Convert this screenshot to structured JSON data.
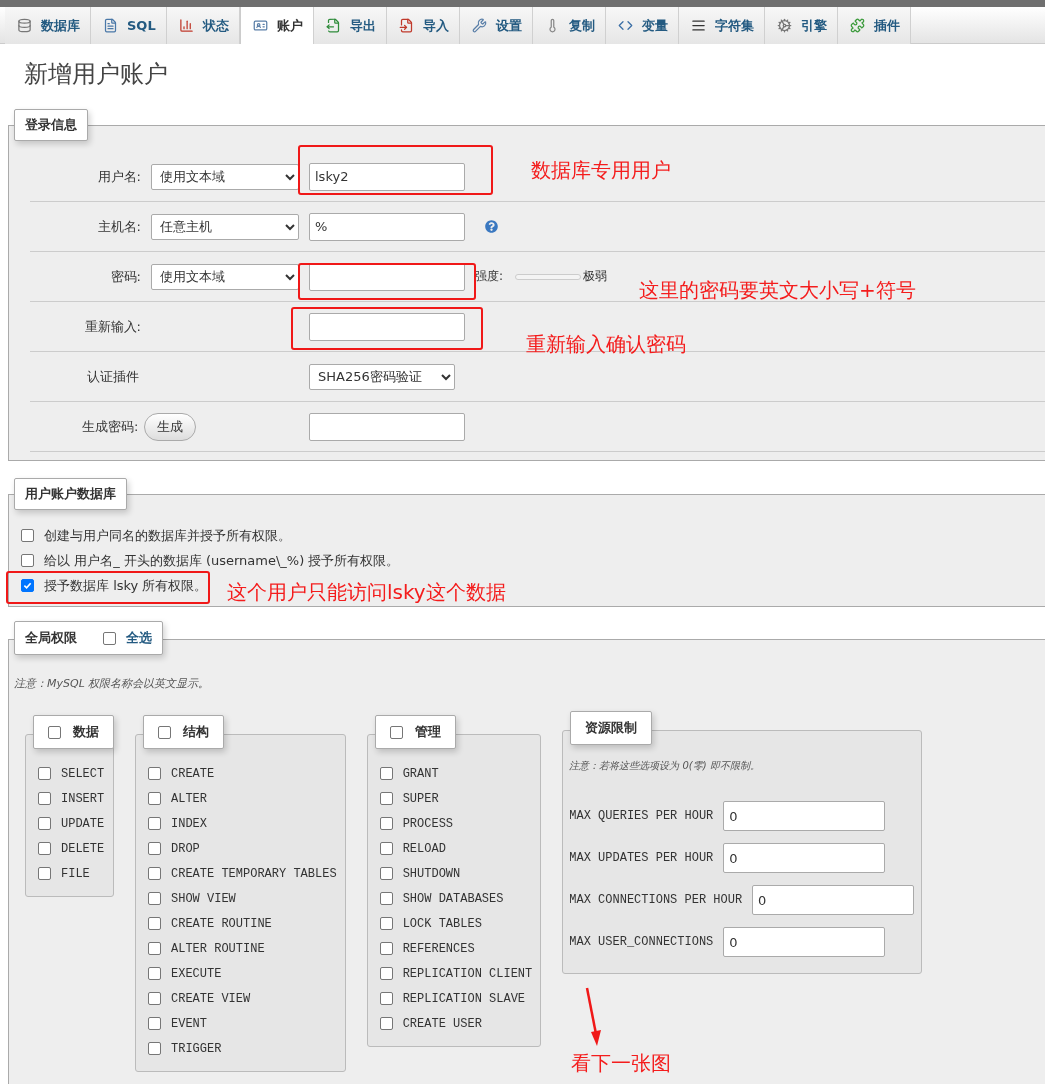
{
  "tabs": [
    {
      "label": "数据库",
      "selected": false
    },
    {
      "label": "SQL",
      "selected": false
    },
    {
      "label": "状态",
      "selected": false
    },
    {
      "label": "账户",
      "selected": true
    },
    {
      "label": "导出",
      "selected": false
    },
    {
      "label": "导入",
      "selected": false
    },
    {
      "label": "设置",
      "selected": false
    },
    {
      "label": "复制",
      "selected": false
    },
    {
      "label": "变量",
      "selected": false
    },
    {
      "label": "字符集",
      "selected": false
    },
    {
      "label": "引擎",
      "selected": false
    },
    {
      "label": "插件",
      "selected": false
    }
  ],
  "title": "新增用户账户",
  "login_info": {
    "legend": "登录信息",
    "rows": [
      {
        "kind": "select_input",
        "label": "用户名:",
        "select": "使用文本域",
        "value": "lsky2"
      },
      {
        "kind": "select_input_help",
        "label": "主机名:",
        "select": "任意主机",
        "value": "%"
      },
      {
        "kind": "password",
        "label": "密码:",
        "select": "使用文本域",
        "strength_label": "强度:",
        "level": 0,
        "strength_text": "极弱"
      },
      {
        "kind": "retype",
        "label": "重新输入:"
      },
      {
        "kind": "plugin",
        "label": "认证插件",
        "select": "SHA256密码验证"
      },
      {
        "kind": "generate",
        "label": "生成密码:",
        "button": "生成"
      }
    ]
  },
  "user_database": {
    "legend": "用户账户数据库",
    "options": [
      {
        "label": "创建与用户同名的数据库并授予所有权限。",
        "checked": false
      },
      {
        "label": "给以 用户名_ 开头的数据库 (username\\_%) 授予所有权限。",
        "checked": false
      },
      {
        "label": "授予数据库 lsky 所有权限。",
        "checked": true
      }
    ]
  },
  "global_privileges": {
    "legend": "全局权限",
    "select_all": {
      "label": "全选",
      "checked": false
    },
    "note": "注意：MySQL 权限名称会以英文显示。",
    "groups": [
      {
        "title": "数据",
        "checked": false,
        "items": [
          {
            "label": "SELECT",
            "checked": false
          },
          {
            "label": "INSERT",
            "checked": false
          },
          {
            "label": "UPDATE",
            "checked": false
          },
          {
            "label": "DELETE",
            "checked": false
          },
          {
            "label": "FILE",
            "checked": false
          }
        ]
      },
      {
        "title": "结构",
        "checked": false,
        "items": [
          {
            "label": "CREATE",
            "checked": false
          },
          {
            "label": "ALTER",
            "checked": false
          },
          {
            "label": "INDEX",
            "checked": false
          },
          {
            "label": "DROP",
            "checked": false
          },
          {
            "label": "CREATE TEMPORARY TABLES",
            "checked": false
          },
          {
            "label": "SHOW VIEW",
            "checked": false
          },
          {
            "label": "CREATE ROUTINE",
            "checked": false
          },
          {
            "label": "ALTER ROUTINE",
            "checked": false
          },
          {
            "label": "EXECUTE",
            "checked": false
          },
          {
            "label": "CREATE VIEW",
            "checked": false
          },
          {
            "label": "EVENT",
            "checked": false
          },
          {
            "label": "TRIGGER",
            "checked": false
          }
        ]
      },
      {
        "title": "管理",
        "checked": false,
        "items": [
          {
            "label": "GRANT",
            "checked": false
          },
          {
            "label": "SUPER",
            "checked": false
          },
          {
            "label": "PROCESS",
            "checked": false
          },
          {
            "label": "RELOAD",
            "checked": false
          },
          {
            "label": "SHUTDOWN",
            "checked": false
          },
          {
            "label": "SHOW DATABASES",
            "checked": false
          },
          {
            "label": "LOCK TABLES",
            "checked": false
          },
          {
            "label": "REFERENCES",
            "checked": false
          },
          {
            "label": "REPLICATION CLIENT",
            "checked": false
          },
          {
            "label": "REPLICATION SLAVE",
            "checked": false
          },
          {
            "label": "CREATE USER",
            "checked": false
          }
        ]
      }
    ],
    "resource_limits": {
      "title": "资源限制",
      "note": "注意：若将这些选项设为 0(零) 即不限制。",
      "items": [
        {
          "label": "MAX QUERIES PER HOUR",
          "value": "0"
        },
        {
          "label": "MAX UPDATES PER HOUR",
          "value": "0"
        },
        {
          "label": "MAX CONNECTIONS PER HOUR",
          "value": "0"
        },
        {
          "label": "MAX USER_CONNECTIONS",
          "value": "0"
        }
      ]
    }
  },
  "annotations": [
    {
      "text": "数据库专用用户"
    },
    {
      "text": "这里的密码要英文大小写+符号"
    },
    {
      "text": "重新输入确认密码"
    },
    {
      "text": "这个用户只能访问lsky这个数据"
    },
    {
      "text": "看下一张图"
    }
  ]
}
